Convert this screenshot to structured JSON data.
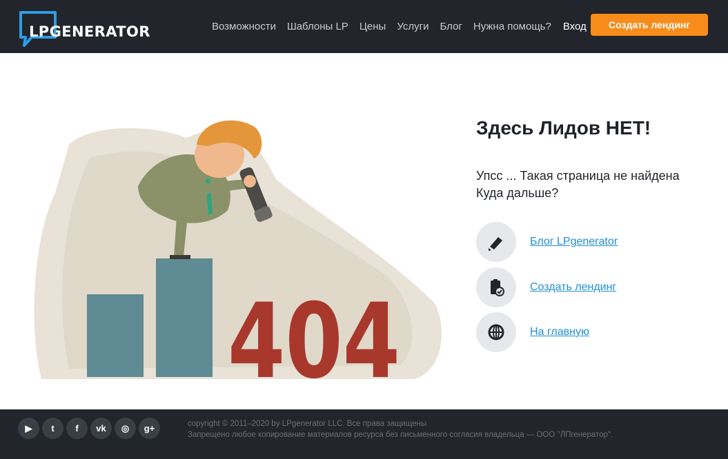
{
  "header": {
    "logo_text": "LPGENERATOR",
    "nav": [
      {
        "label": "Возможности"
      },
      {
        "label": "Шаблоны LP"
      },
      {
        "label": "Цены"
      },
      {
        "label": "Услуги"
      },
      {
        "label": "Блог"
      },
      {
        "label": "Нужна помощь?"
      }
    ],
    "login_label": "Вход",
    "cta_label": "Создать лендинг"
  },
  "illustration": {
    "code": "404"
  },
  "main": {
    "title": "Здесь Лидов НЕТ!",
    "subtitle_line1": "Упсс ... Такая страница не найдена",
    "subtitle_line2": "Куда дальше?",
    "links": [
      {
        "label": "Блог LPgenerator",
        "icon": "pencil-icon"
      },
      {
        "label": "Создать лендинг",
        "icon": "clipboard-check-icon"
      },
      {
        "label": "На главную",
        "icon": "globe-icon"
      }
    ]
  },
  "footer": {
    "socials": [
      {
        "name": "youtube-icon",
        "glyph": "▶"
      },
      {
        "name": "twitter-icon",
        "glyph": "t"
      },
      {
        "name": "facebook-icon",
        "glyph": "f"
      },
      {
        "name": "vk-icon",
        "glyph": "vk"
      },
      {
        "name": "instagram-icon",
        "glyph": "◎"
      },
      {
        "name": "googleplus-icon",
        "glyph": "g+"
      }
    ],
    "copyright": "copyright © 2011–2020 by LPgenerator LLC. Все права защищены",
    "notice": "Запрещено любое копирование материалов ресурса без письменного согласия владельца — ООО \"ЛПгенератор\"."
  },
  "colors": {
    "header_bg": "#22252c",
    "accent": "#f78c1b",
    "link": "#1e8fd6",
    "bar": "#5e8b94",
    "code_red": "#a8382c"
  }
}
